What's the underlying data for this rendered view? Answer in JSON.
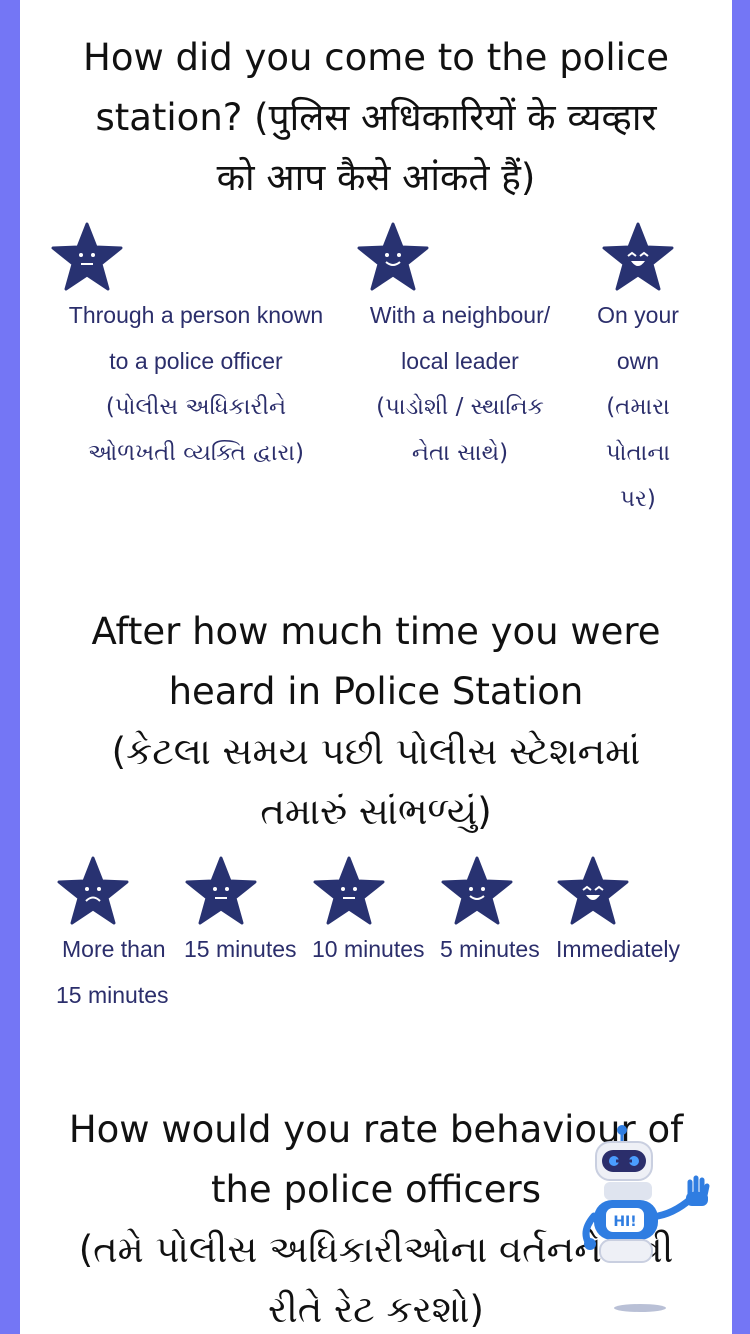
{
  "colors": {
    "background": "#7476f5",
    "card": "#ffffff",
    "star": "#283271",
    "option_text": "#2b2e6b",
    "robot_accent": "#2f7de1"
  },
  "q1": {
    "line1": "How did you come to the police",
    "line2": "station? (पुलिस अधिकारियों के व्यव्हार",
    "line3": "को आप कैसे आंकते हैं)",
    "options": [
      {
        "en1": "Through a person known",
        "en2": "to a police officer",
        "gu1": "(પોલીસ અધિકારીને",
        "gu2": "ઓળખતી વ્યક્તિ દ્વારા)",
        "icon": "neutral-star-icon"
      },
      {
        "en1": "With a neighbour/",
        "en2": "local leader",
        "gu1": "(પાડોશી / સ્થાનિક",
        "gu2": "નેતા સાથે)",
        "icon": "smile-star-icon"
      },
      {
        "en1": "On your",
        "en2": "own",
        "gu1": "(તમારા",
        "gu2": "પોતાના",
        "gu3": "પર)",
        "icon": "happy-star-icon"
      }
    ]
  },
  "q2": {
    "line1": "After how much time you were",
    "line2": "heard in Police Station",
    "line3": "(કેટલા સમય પછી પોલીસ સ્ટેશનમાં",
    "line4": "તમારું સાંભળ્યું)",
    "options": [
      {
        "en1": "More than",
        "en2": "15 minutes",
        "icon": "sad-star-icon"
      },
      {
        "en1": "15 minutes",
        "icon": "neutral-star-icon"
      },
      {
        "en1": "10 minutes",
        "icon": "neutral-star-icon"
      },
      {
        "en1": "5 minutes",
        "icon": "smile-star-icon"
      },
      {
        "en1": "Immediately",
        "icon": "happy-star-icon"
      }
    ]
  },
  "q3": {
    "line1": "How would you rate behaviour of",
    "line2": "the police officers",
    "line3": "(તમે પોલીસ અધિકારીઓના વર્તનને કેવી",
    "line4": "રીતે રેટ કરશો)"
  },
  "chatbot": {
    "badge": "HI!"
  }
}
